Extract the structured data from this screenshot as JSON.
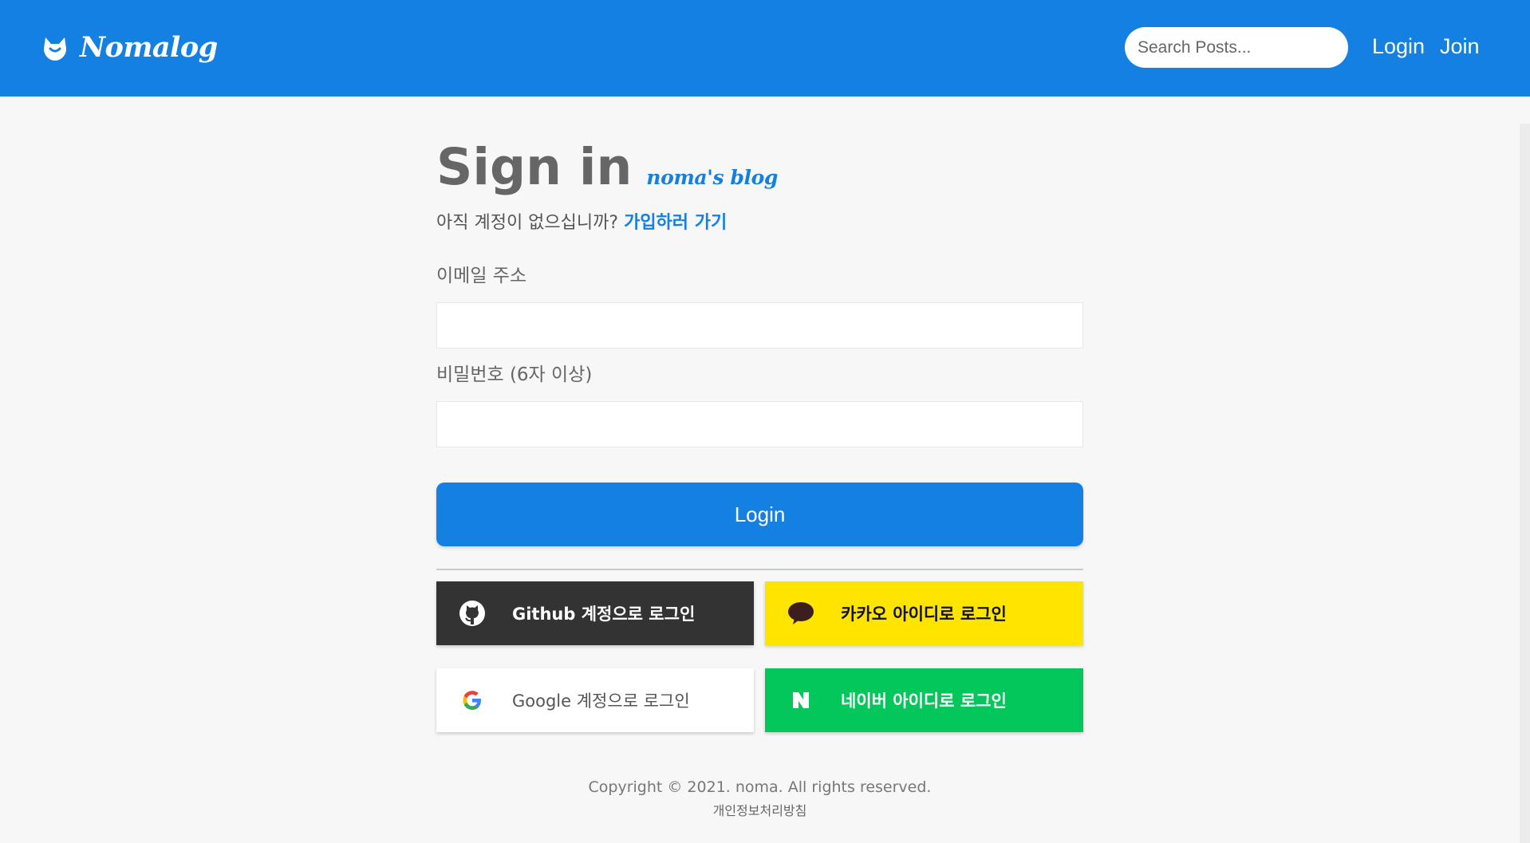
{
  "header": {
    "brand": "Nomalog",
    "search_placeholder": "Search Posts...",
    "nav": {
      "login": "Login",
      "join": "Join"
    }
  },
  "signin": {
    "title": "Sign in",
    "subtitle": "noma's blog",
    "no_account_text": "아직 계정이 없으십니까?",
    "signup_link": "가입하러 가기",
    "email_label": "이메일 주소",
    "password_label": "비밀번호 (6자 이상)",
    "login_button": "Login"
  },
  "social": {
    "github": "Github 계정으로 로그인",
    "kakao": "카카오 아이디로 로그인",
    "google": "Google 계정으로 로그인",
    "naver": "네이버 아이디로 로그인"
  },
  "footer": {
    "copyright": "Copyright © 2021. noma. All rights reserved.",
    "privacy": "개인정보처리방침"
  },
  "colors": {
    "primary": "#1380e2",
    "github": "#333333",
    "kakao": "#fee500",
    "naver": "#03c75a",
    "background": "#f7f7f7"
  },
  "icons": {
    "logo": "cat-face-icon",
    "github": "github-icon",
    "kakao": "speech-bubble-icon",
    "google": "google-g-icon",
    "naver": "naver-n-icon"
  }
}
